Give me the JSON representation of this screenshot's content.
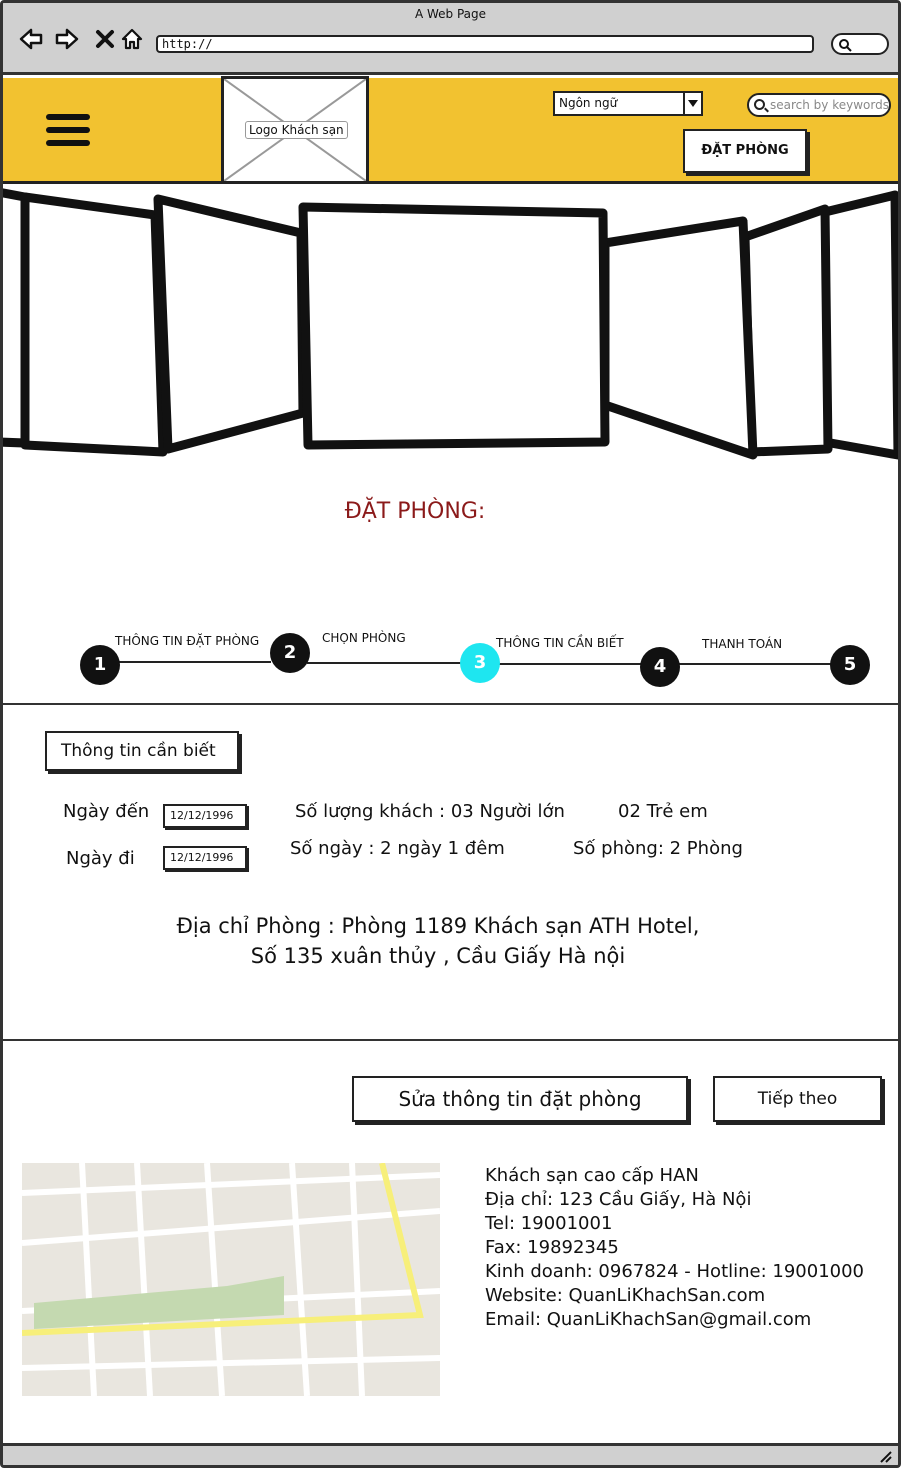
{
  "browser": {
    "window_title": "A Web Page",
    "url": "http://"
  },
  "header": {
    "logo_label": "Logo Khách sạn",
    "language_select": "Ngôn ngữ",
    "search_placeholder": "search by keywords",
    "book_button": "ĐẶT PHÒNG",
    "accent_color": "#f2c230"
  },
  "booking": {
    "title": "ĐẶT PHÒNG:",
    "steps": [
      {
        "number": "1",
        "label": "THÔNG TIN ĐẶT PHÒNG"
      },
      {
        "number": "2",
        "label": "CHỌN PHÒNG"
      },
      {
        "number": "3",
        "label": "THÔNG TIN CẦN BIẾT",
        "active": true
      },
      {
        "number": "4",
        "label": "THANH TOÁN"
      },
      {
        "number": "5",
        "label": ""
      }
    ],
    "active_step_color": "#1ee6f0"
  },
  "info": {
    "section_title": "Thông tin cần biết",
    "arrival_label": "Ngày đến",
    "arrival_value": "12/12/1996",
    "departure_label": "Ngày đi",
    "departure_value": "12/12/1996",
    "guests": "Số lượng khách : 03 Người lớn",
    "children": "02 Trẻ em",
    "days": "Số ngày : 2 ngày 1 đêm",
    "rooms": "Số phòng: 2 Phòng",
    "address_line1": "Địa chỉ Phòng : Phòng 1189 Khách sạn ATH Hotel,",
    "address_line2": "Số 135 xuân thủy , Cầu Giấy Hà nội"
  },
  "actions": {
    "edit_button": "Sửa thông tin đặt phòng",
    "next_button": "Tiếp theo"
  },
  "contact": {
    "name": "Khách sạn cao cấp HAN",
    "address": "Địa chỉ: 123 Cầu Giấy, Hà Nội",
    "tel": "Tel: 19001001",
    "fax": "Fax: 19892345",
    "business": "Kinh doanh: 0967824 - Hotline: 19001000",
    "website": "Website: QuanLiKhachSan.com",
    "email": "Email: QuanLiKhachSan@gmail.com"
  }
}
